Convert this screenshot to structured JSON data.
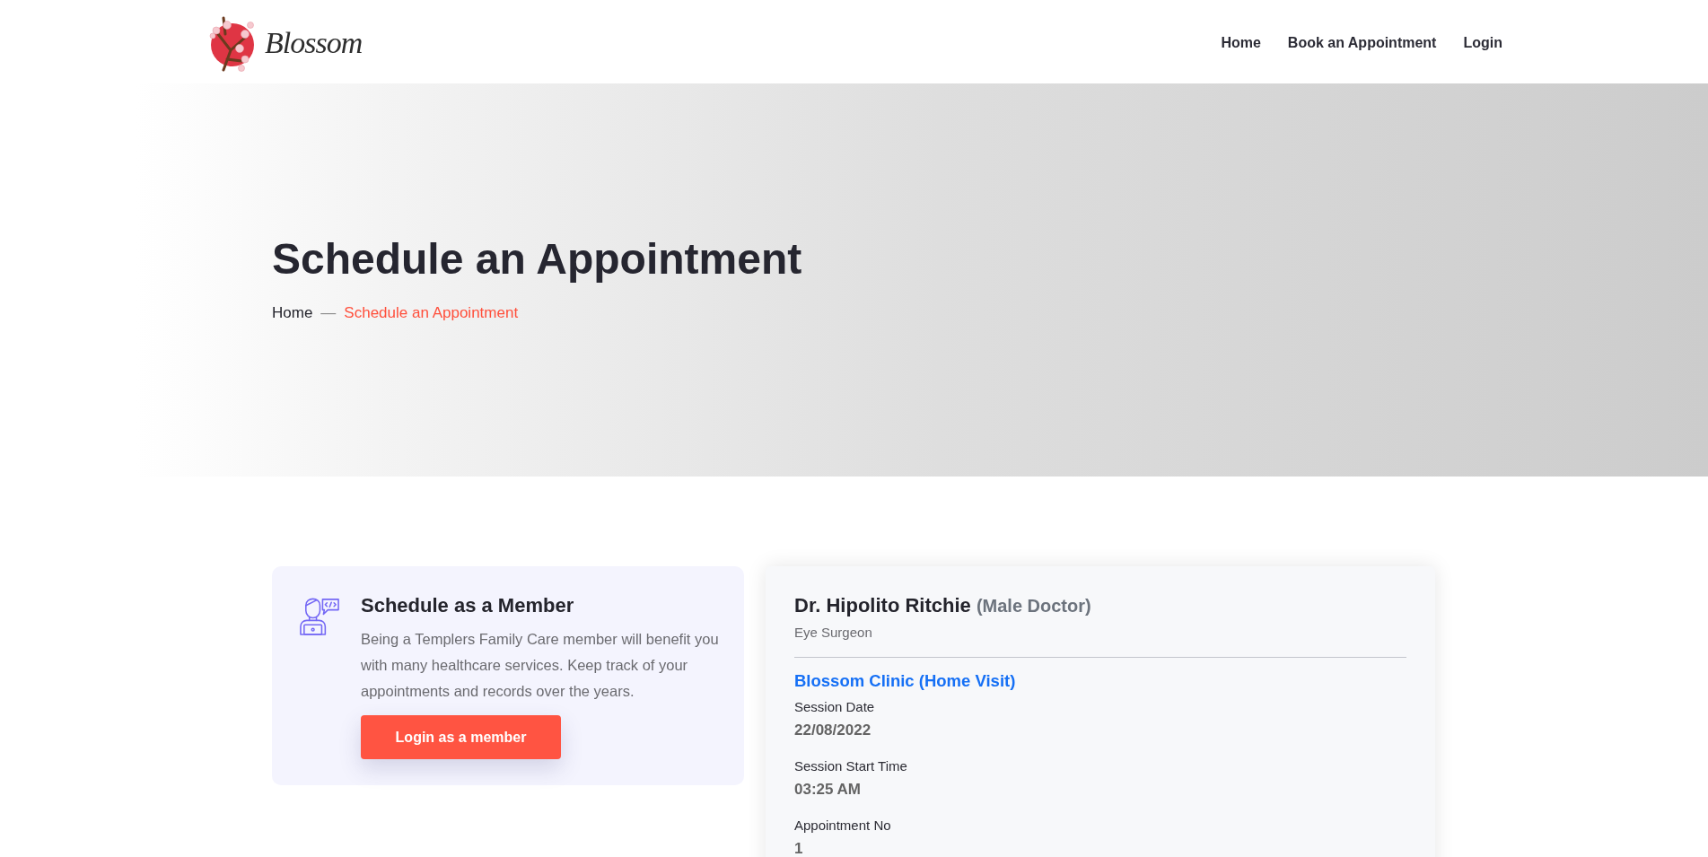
{
  "header": {
    "logo_text": "Blossom",
    "nav": [
      {
        "label": "Home"
      },
      {
        "label": "Book an Appointment"
      },
      {
        "label": "Login"
      }
    ]
  },
  "hero": {
    "title": "Schedule an Appointment",
    "separator": "—",
    "breadcrumb": [
      {
        "label": "Home",
        "current": false
      },
      {
        "label": "Schedule an Appointment",
        "current": true
      }
    ]
  },
  "member_card": {
    "title": "Schedule as a Member",
    "description": "Being a Templers Family Care member will benefit you with many healthcare services. Keep track of your appointments and records over the years.",
    "button": "Login as a member"
  },
  "doctor_card": {
    "name": "Dr. Hipolito Ritchie",
    "gender": "(Male Doctor)",
    "specialty": "Eye Surgeon",
    "clinic": "Blossom Clinic (Home Visit)",
    "fields": [
      {
        "label": "Session Date",
        "value": "22/08/2022"
      },
      {
        "label": "Session Start Time",
        "value": "03:25 AM"
      },
      {
        "label": "Appointment No",
        "value": "1"
      }
    ]
  }
}
